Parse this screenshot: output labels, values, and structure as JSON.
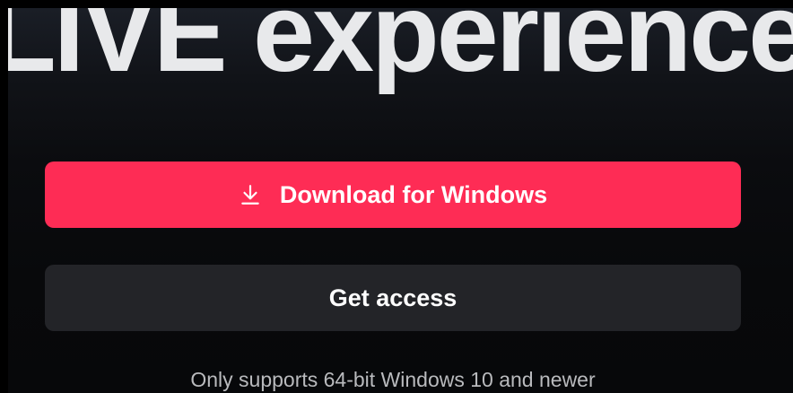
{
  "hero": {
    "title": "LIVE experience"
  },
  "download_button": {
    "icon": "download-icon",
    "label": "Download for Windows",
    "color": "#fe2c55"
  },
  "access_button": {
    "label": "Get access",
    "color": "#232428"
  },
  "note": {
    "text": "Only supports 64-bit Windows 10 and newer"
  }
}
